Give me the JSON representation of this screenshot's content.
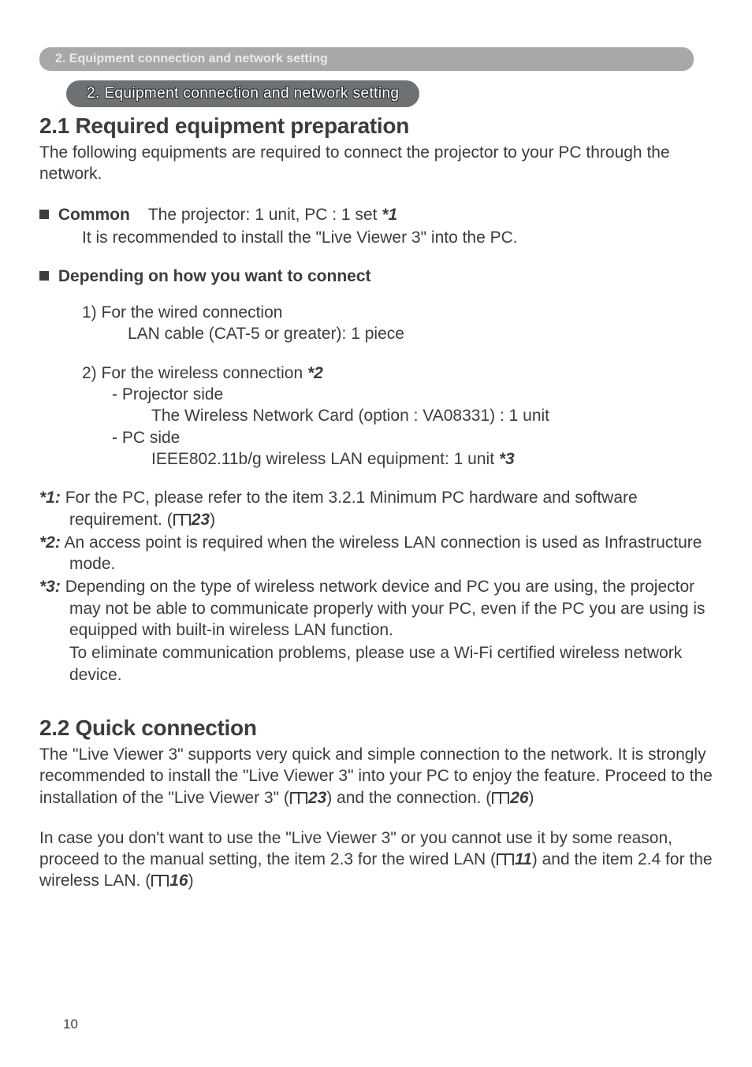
{
  "breadcrumb": "2. Equipment connection and network setting",
  "section_pill": "2. Equipment connection and network setting",
  "h21": "2.1 Required equipment preparation",
  "intro_21": "The following equipments are required to connect the projector to your PC through the network.",
  "common_label": "Common",
  "common_line_rest": "The projector: 1 unit,    PC : 1 set ",
  "common_fn_ref": "*1",
  "common_sub": "It is recommended to install the \"Live Viewer 3\" into the PC.",
  "depending_label": "Depending on how you want to connect",
  "wired_head": "1) For the wired connection",
  "wired_detail": "LAN cable (CAT-5 or greater): 1 piece",
  "wireless_head_a": "2) For the wireless connection ",
  "wireless_head_fn": "*2",
  "proj_side": "- Projector side",
  "proj_side_detail": "The Wireless Network Card (option : VA08331) : 1 unit",
  "pc_side": "- PC side",
  "pc_side_detail_a": "IEEE802.11b/g wireless LAN equipment: 1 unit ",
  "pc_side_detail_fn": "*3",
  "fn1_label": "*1:",
  "fn1_a": " For the PC, please refer to the item 3.2.1 Minimum PC hardware and software requirement. (",
  "fn1_ref": "23",
  "fn1_b": ")",
  "fn2_label": "*2:",
  "fn2_text": " An access point is required when the wireless LAN connection is used as Infrastructure mode.",
  "fn3_label": "*3:",
  "fn3_text": " Depending on the type of wireless network device and PC you are using, the projector may not be able to communicate properly with your PC, even if the PC you are using is equipped with built-in wireless LAN function.",
  "fn3_cont": "To eliminate communication problems, please use a Wi-Fi certified wireless network device.",
  "h22": "2.2 Quick connection",
  "q1_a": "The \"Live Viewer 3\" supports very quick and simple connection to the network. It is strongly recommended to install the \"Live Viewer 3\" into your PC to enjoy the feature. Proceed to the installation of the \"Live Viewer 3\" (",
  "q1_ref1": "23",
  "q1_b": ") and the connection. (",
  "q1_ref2": "26",
  "q1_c": ")",
  "q2_a": "In case you don't want to use the \"Live Viewer 3\" or you cannot use it by some reason, proceed to the manual setting, the item 2.3 for the wired LAN (",
  "q2_ref1": "11",
  "q2_b": ") and the item 2.4 for the wireless LAN. (",
  "q2_ref2": "16",
  "q2_c": ")",
  "page_number": "10"
}
